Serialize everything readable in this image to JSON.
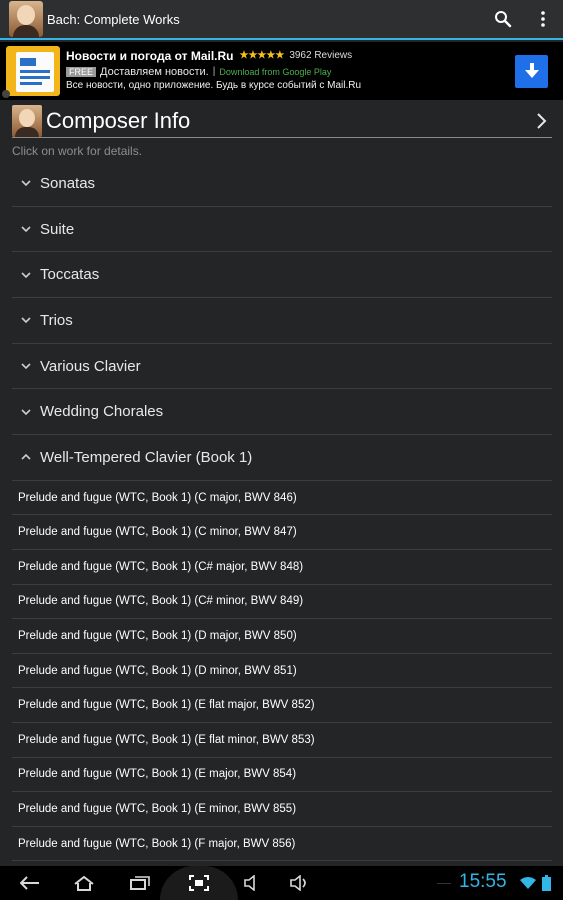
{
  "app": {
    "title": "Bach: Complete Works"
  },
  "ad": {
    "title": "Новости и погода от Mail.Ru",
    "stars": "★★★★★",
    "reviews": "3962 Reviews",
    "free": "FREE",
    "tagline": "Доставляем новости.",
    "separator": "|",
    "store": "Download from Google Play",
    "description": "Все новости, одно приложение. Будь в курсе событий с Mail.Ru"
  },
  "composer": {
    "title": "Composer Info",
    "hint": "Click on work for details."
  },
  "categories": [
    {
      "label": "Sonatas"
    },
    {
      "label": "Suite"
    },
    {
      "label": "Toccatas"
    },
    {
      "label": "Trios"
    },
    {
      "label": "Various Clavier"
    },
    {
      "label": "Wedding Chorales"
    },
    {
      "label": "Well-Tempered Clavier (Book 1)"
    }
  ],
  "works": [
    "Prelude and fugue (WTC, Book 1) (C major, BWV 846)",
    "Prelude and fugue (WTC, Book 1) (C minor, BWV 847)",
    "Prelude and fugue (WTC, Book 1) (C# major, BWV 848)",
    "Prelude and fugue (WTC, Book 1) (C# minor, BWV 849)",
    "Prelude and fugue (WTC, Book 1) (D major, BWV 850)",
    "Prelude and fugue (WTC, Book 1) (D minor, BWV 851)",
    "Prelude and fugue (WTC, Book 1) (E flat major, BWV 852)",
    "Prelude and fugue (WTC, Book 1) (E flat minor, BWV 853)",
    "Prelude and fugue (WTC, Book 1) (E major, BWV 854)",
    "Prelude and fugue (WTC, Book 1) (E minor, BWV 855)",
    "Prelude and fugue (WTC, Book 1) (F major, BWV 856)"
  ],
  "status": {
    "time": "15:55"
  },
  "colors": {
    "accent": "#33b5e5",
    "download": "#1e6fe8",
    "stars": "#f4c21b"
  }
}
